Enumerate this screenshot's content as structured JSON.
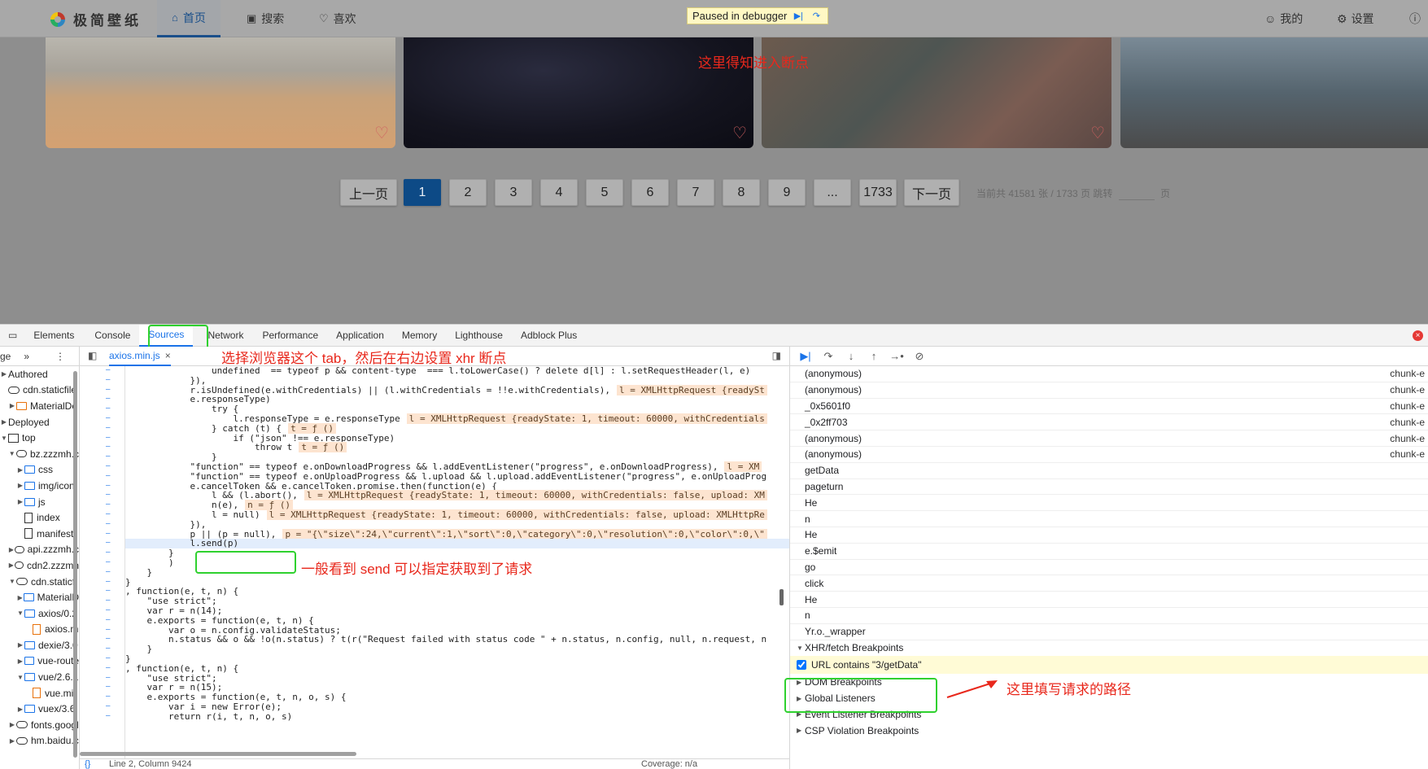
{
  "site": {
    "logo_text": "极简壁纸",
    "nav": [
      {
        "label": "首页",
        "icon": "home-icon"
      },
      {
        "label": "搜索",
        "icon": "image-search-icon"
      },
      {
        "label": "喜欢",
        "icon": "heart-icon"
      }
    ],
    "debugger_banner": "Paused in debugger",
    "right_nav": [
      {
        "label": "我的",
        "icon": "user-icon"
      },
      {
        "label": "设置",
        "icon": "gear-icon"
      }
    ],
    "pagination": {
      "prev": "上一页",
      "pages": [
        "1",
        "2",
        "3",
        "4",
        "5",
        "6",
        "7",
        "8",
        "9",
        "...",
        "1733"
      ],
      "current": "1",
      "next": "下一页",
      "info": "当前共 41581 张 / 1733 页 跳转",
      "page_suffix": "页"
    },
    "annotation_top": "这里得知进入断点"
  },
  "devtools": {
    "tabs": [
      "Elements",
      "Console",
      "Sources",
      "Network",
      "Performance",
      "Application",
      "Memory",
      "Lighthouse",
      "Adblock Plus"
    ],
    "active_tab": "Sources",
    "annotation_tab": "选择浏览器这个 tab，然后在右边设置 xhr 断点",
    "navigator": {
      "head": "ge",
      "rows": [
        {
          "label": "Authored",
          "type": "none",
          "indent": 0,
          "tw": "▶"
        },
        {
          "label": "cdn.staticfile",
          "type": "cloud",
          "indent": 0,
          "tw": ""
        },
        {
          "label": "MaterialDe",
          "type": "folder-or",
          "indent": 1,
          "tw": "▶"
        },
        {
          "label": "Deployed",
          "type": "none",
          "indent": 0,
          "tw": "▶"
        },
        {
          "label": "top",
          "type": "box",
          "indent": 0,
          "tw": "▼"
        },
        {
          "label": "bz.zzzmh.c",
          "type": "cloud",
          "indent": 1,
          "tw": "▼"
        },
        {
          "label": "css",
          "type": "folder",
          "indent": 2,
          "tw": "▶"
        },
        {
          "label": "img/icon",
          "type": "folder",
          "indent": 2,
          "tw": "▶"
        },
        {
          "label": "js",
          "type": "folder",
          "indent": 2,
          "tw": "▶"
        },
        {
          "label": "index",
          "type": "file",
          "indent": 2,
          "tw": ""
        },
        {
          "label": "manifest",
          "type": "file",
          "indent": 2,
          "tw": ""
        },
        {
          "label": "api.zzzmh.c",
          "type": "cloud",
          "indent": 1,
          "tw": "▶"
        },
        {
          "label": "cdn2.zzzmh",
          "type": "cloud",
          "indent": 1,
          "tw": "▶"
        },
        {
          "label": "cdn.staticfi",
          "type": "cloud",
          "indent": 1,
          "tw": "▼"
        },
        {
          "label": "MaterialD",
          "type": "folder",
          "indent": 2,
          "tw": "▶"
        },
        {
          "label": "axios/0.2",
          "type": "folder",
          "indent": 2,
          "tw": "▼"
        },
        {
          "label": "axios.m",
          "type": "file-or",
          "indent": 3,
          "tw": ""
        },
        {
          "label": "dexie/3.0",
          "type": "folder",
          "indent": 2,
          "tw": "▶"
        },
        {
          "label": "vue-route",
          "type": "folder",
          "indent": 2,
          "tw": "▶"
        },
        {
          "label": "vue/2.6.1",
          "type": "folder",
          "indent": 2,
          "tw": "▼"
        },
        {
          "label": "vue.mi",
          "type": "file-or",
          "indent": 3,
          "tw": ""
        },
        {
          "label": "vuex/3.6.",
          "type": "folder",
          "indent": 2,
          "tw": "▶"
        },
        {
          "label": "fonts.googl",
          "type": "cloud",
          "indent": 1,
          "tw": "▶"
        },
        {
          "label": "hm.baidu.c",
          "type": "cloud",
          "indent": 1,
          "tw": "▶"
        }
      ]
    },
    "editor": {
      "file_tab": "axios.min.js",
      "annotation_send": "一般看到 send 可以指定获取到了请求",
      "status_pos": "Line 2, Column 9424",
      "status_cov": "Coverage: n/a",
      "lines": [
        {
          "text": "                undefined  == typeof p && content-type  === l.toLowerCase() ? delete d[l] : l.setRequestHeader(l, e)",
          "inline": ""
        },
        {
          "text": "            }),",
          "inline": ""
        },
        {
          "text": "            r.isUndefined(e.withCredentials) || (l.withCredentials = !!e.withCredentials),",
          "inline": "l = XMLHttpRequest {readySt"
        },
        {
          "text": "            e.responseType)",
          "inline": ""
        },
        {
          "text": "                try {",
          "inline": ""
        },
        {
          "text": "                    l.responseType = e.responseType",
          "inline": "l = XMLHttpRequest {readyState: 1, timeout: 60000, withCredentials"
        },
        {
          "text": "                } catch (t) {",
          "inline": "t = ƒ ()"
        },
        {
          "text": "                    if (\"json\" !== e.responseType)",
          "inline": ""
        },
        {
          "text": "                        throw t",
          "inline": "t = ƒ ()"
        },
        {
          "text": "                }",
          "inline": ""
        },
        {
          "text": "            \"function\" == typeof e.onDownloadProgress && l.addEventListener(\"progress\", e.onDownloadProgress),",
          "inline": "l = XM"
        },
        {
          "text": "            \"function\" == typeof e.onUploadProgress && l.upload && l.upload.addEventListener(\"progress\", e.onUploadProg",
          "inline": ""
        },
        {
          "text": "            e.cancelToken && e.cancelToken.promise.then(function(e) {",
          "inline": ""
        },
        {
          "text": "                l && (l.abort(),",
          "inline": "l = XMLHttpRequest {readyState: 1, timeout: 60000, withCredentials: false, upload: XM"
        },
        {
          "text": "                n(e),",
          "inline": "n = ƒ ()"
        },
        {
          "text": "                l = null)",
          "inline": "l = XMLHttpRequest {readyState: 1, timeout: 60000, withCredentials: false, upload: XMLHttpRe"
        },
        {
          "text": "            }),",
          "inline": ""
        },
        {
          "text": "            p || (p = null),",
          "inline": "p = \"{\\\"size\\\":24,\\\"current\\\":1,\\\"sort\\\":0,\\\"category\\\":0,\\\"resolution\\\":0,\\\"color\\\":0,\\\""
        },
        {
          "text": "            l.send(p)",
          "inline": ""
        },
        {
          "text": "        }",
          "inline": ""
        },
        {
          "text": "        )",
          "inline": ""
        },
        {
          "text": "    }",
          "inline": ""
        },
        {
          "text": "}",
          "inline": ""
        },
        {
          "text": ", function(e, t, n) {",
          "inline": ""
        },
        {
          "text": "    \"use strict\";",
          "inline": ""
        },
        {
          "text": "    var r = n(14);",
          "inline": ""
        },
        {
          "text": "    e.exports = function(e, t, n) {",
          "inline": ""
        },
        {
          "text": "        var o = n.config.validateStatus;",
          "inline": ""
        },
        {
          "text": "        n.status && o && !o(n.status) ? t(r(\"Request failed with status code \" + n.status, n.config, null, n.request, n",
          "inline": ""
        },
        {
          "text": "    }",
          "inline": ""
        },
        {
          "text": "}",
          "inline": ""
        },
        {
          "text": ", function(e, t, n) {",
          "inline": ""
        },
        {
          "text": "    \"use strict\";",
          "inline": ""
        },
        {
          "text": "    var r = n(15);",
          "inline": ""
        },
        {
          "text": "    e.exports = function(e, t, n, o, s) {",
          "inline": ""
        },
        {
          "text": "        var i = new Error(e);",
          "inline": ""
        },
        {
          "text": "        return r(i, t, n, o, s)",
          "inline": ""
        }
      ]
    },
    "call_stack": [
      {
        "fn": "(anonymous)",
        "src": "chunk-e"
      },
      {
        "fn": "(anonymous)",
        "src": "chunk-e"
      },
      {
        "fn": "_0x5601f0",
        "src": "chunk-e"
      },
      {
        "fn": "_0x2ff703",
        "src": "chunk-e"
      },
      {
        "fn": "(anonymous)",
        "src": "chunk-e"
      },
      {
        "fn": "(anonymous)",
        "src": "chunk-e"
      },
      {
        "fn": "getData",
        "src": ""
      },
      {
        "fn": "pageturn",
        "src": ""
      },
      {
        "fn": "He",
        "src": ""
      },
      {
        "fn": "n",
        "src": ""
      },
      {
        "fn": "He",
        "src": ""
      },
      {
        "fn": "e.$emit",
        "src": ""
      },
      {
        "fn": "go",
        "src": ""
      },
      {
        "fn": "click",
        "src": ""
      },
      {
        "fn": "He",
        "src": ""
      },
      {
        "fn": "n",
        "src": ""
      },
      {
        "fn": "Yr.o._wrapper",
        "src": ""
      }
    ],
    "xhr_section": "XHR/fetch Breakpoints",
    "xhr_breakpoint": "URL contains \"3/getData\"",
    "annotation_xhr": "这里填写请求的路径",
    "sections": [
      "DOM Breakpoints",
      "Global Listeners",
      "Event Listener Breakpoints",
      "CSP Violation Breakpoints"
    ]
  }
}
